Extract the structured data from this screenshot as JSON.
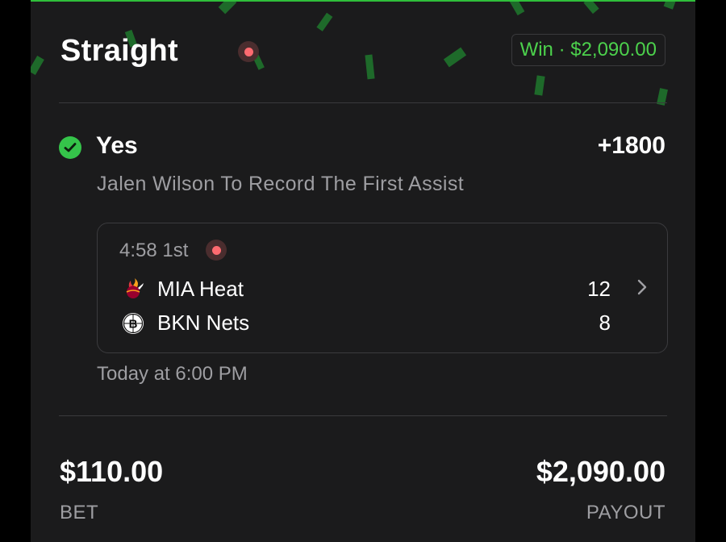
{
  "bet": {
    "type": "Straight",
    "result_badge": "Win · $2,090.00",
    "pick_label": "Yes",
    "odds": "+1800",
    "market": "Jalen Wilson To Record The First Assist",
    "start_time": "Today at 6:00 PM",
    "bet_amount": "$110.00",
    "bet_label": "BET",
    "payout_amount": "$2,090.00",
    "payout_label": "PAYOUT"
  },
  "game": {
    "clock": "4:58 1st",
    "teams": [
      {
        "name": "MIA Heat",
        "score": "12",
        "icon": "miami-heat-logo-icon"
      },
      {
        "name": "BKN Nets",
        "score": "8",
        "icon": "brooklyn-nets-logo-icon"
      }
    ]
  },
  "colors": {
    "background": "#1b1b1c",
    "win_green": "#4cd14c",
    "live_red": "#ff6b70",
    "muted_text": "#9e9ea2"
  }
}
